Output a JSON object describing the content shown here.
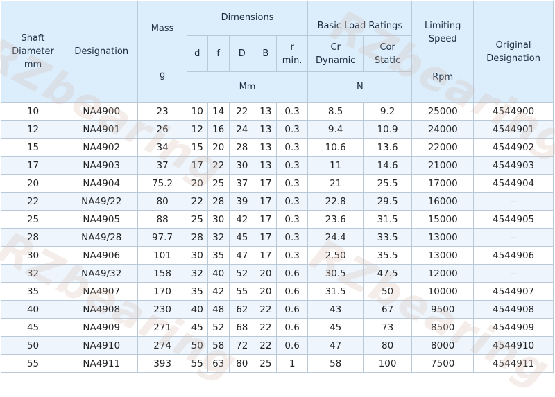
{
  "header": {
    "shaft": [
      "Shaft",
      "Diameter",
      "mm"
    ],
    "designation": "Designation",
    "mass": "Mass",
    "mass_unit": "g",
    "dimensions": "Dimensions",
    "dim_cols": [
      "d",
      "f",
      "D",
      "B"
    ],
    "r": [
      "r",
      "min."
    ],
    "dim_unit": "Mm",
    "load": "Basic Load Ratings",
    "cr": [
      "Cr",
      "Dynamic"
    ],
    "cor": [
      "Cor",
      "Static"
    ],
    "load_unit": "N",
    "limiting": [
      "Limiting",
      "Speed"
    ],
    "limiting_unit": "Rpm",
    "original": [
      "Original",
      "Designation"
    ]
  },
  "rows": [
    [
      "10",
      "NA4900",
      "23",
      "10",
      "14",
      "22",
      "13",
      "0.3",
      "8.5",
      "9.2",
      "25000",
      "4544900"
    ],
    [
      "12",
      "NA4901",
      "26",
      "12",
      "16",
      "24",
      "13",
      "0.3",
      "9.4",
      "10.9",
      "24000",
      "4544901"
    ],
    [
      "15",
      "NA4902",
      "34",
      "15",
      "20",
      "28",
      "13",
      "0.3",
      "10.6",
      "13.6",
      "22000",
      "4544902"
    ],
    [
      "17",
      "NA4903",
      "37",
      "17",
      "22",
      "30",
      "13",
      "0.3",
      "11",
      "14.6",
      "21000",
      "4544903"
    ],
    [
      "20",
      "NA4904",
      "75.2",
      "20",
      "25",
      "37",
      "17",
      "0.3",
      "21",
      "25.5",
      "17000",
      "4544904"
    ],
    [
      "22",
      "NA49/22",
      "80",
      "22",
      "28",
      "39",
      "17",
      "0.3",
      "22.8",
      "29.5",
      "16000",
      "--"
    ],
    [
      "25",
      "NA4905",
      "88",
      "25",
      "30",
      "42",
      "17",
      "0.3",
      "23.6",
      "31.5",
      "15000",
      "4544905"
    ],
    [
      "28",
      "NA49/28",
      "97.7",
      "28",
      "32",
      "45",
      "17",
      "0.3",
      "24.4",
      "33.5",
      "13000",
      "--"
    ],
    [
      "30",
      "NA4906",
      "101",
      "30",
      "35",
      "47",
      "17",
      "0.3",
      "2.50",
      "35.5",
      "13000",
      "4544906"
    ],
    [
      "32",
      "NA49/32",
      "158",
      "32",
      "40",
      "52",
      "20",
      "0.6",
      "30.5",
      "47.5",
      "12000",
      "--"
    ],
    [
      "35",
      "NA4907",
      "170",
      "35",
      "42",
      "55",
      "20",
      "0.6",
      "31.5",
      "50",
      "10000",
      "4544907"
    ],
    [
      "40",
      "NA4908",
      "230",
      "40",
      "48",
      "62",
      "22",
      "0.6",
      "43",
      "67",
      "9500",
      "4544908"
    ],
    [
      "45",
      "NA4909",
      "271",
      "45",
      "52",
      "68",
      "22",
      "0.6",
      "45",
      "73",
      "8500",
      "4544909"
    ],
    [
      "50",
      "NA4910",
      "274",
      "50",
      "58",
      "72",
      "22",
      "0.6",
      "47",
      "80",
      "8000",
      "4544910"
    ],
    [
      "55",
      "NA4911",
      "393",
      "55",
      "63",
      "80",
      "25",
      "1",
      "58",
      "100",
      "7500",
      "4544911"
    ]
  ],
  "watermark": "RZbearing"
}
